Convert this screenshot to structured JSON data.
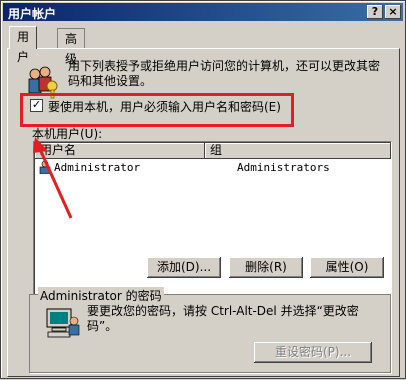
{
  "window": {
    "title": "用户帐户",
    "help_btn": "?",
    "close_btn": "×"
  },
  "tabs": [
    {
      "label": "用户",
      "active": true
    },
    {
      "label": "高级",
      "active": false
    }
  ],
  "intro_text": "用下列表授予或拒绝用户访问您的计算机，还可以更改其密码和其他设置。",
  "checkbox": {
    "checked": true,
    "label": "要使用本机，用户必须输入用户名和密码(E)"
  },
  "list": {
    "label": "本机用户(U):",
    "columns": [
      "用户名",
      "组"
    ],
    "rows": [
      {
        "user": "Administrator",
        "group": "Administrators"
      }
    ]
  },
  "buttons": {
    "add": "添加(D)...",
    "remove": "删除(R)",
    "properties": "属性(O)"
  },
  "password_group": {
    "title": "Administrator 的密码",
    "text": "要更改您的密码，请按 Ctrl-Alt-Del 并选择“更改密码”。",
    "reset_button": "重设密码(P)..."
  },
  "colors": {
    "titlebar_start": "#0a246a",
    "titlebar_end": "#3a6ea5",
    "annotation_red": "#e02020"
  }
}
